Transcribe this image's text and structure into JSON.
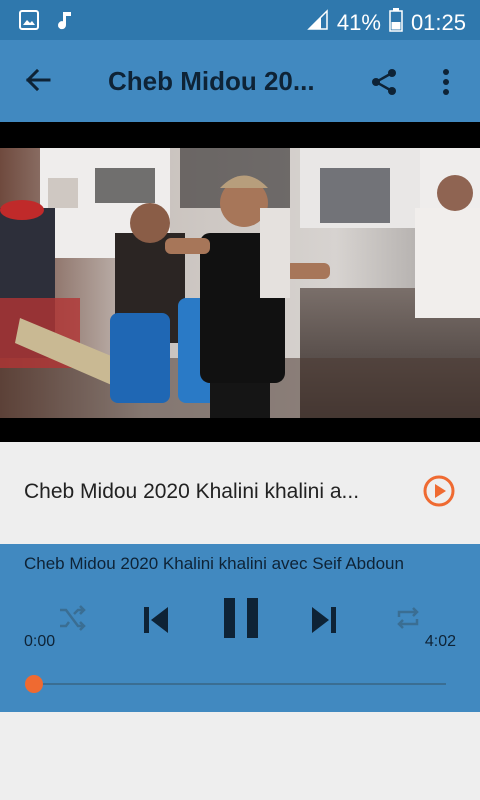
{
  "status_bar": {
    "battery": "41%",
    "time": "01:25",
    "icons": [
      "image-icon",
      "music-note-icon",
      "signal-icon",
      "battery-icon"
    ]
  },
  "app_bar": {
    "title": "Cheb Midou 20...",
    "icons": [
      "back-arrow-icon",
      "share-icon",
      "more-vert-icon"
    ]
  },
  "track_row": {
    "title": "Cheb Midou 2020 Khalini khalini a..."
  },
  "player": {
    "now_playing": "Cheb Midou 2020 Khalini khalini avec Seif Abdoun",
    "elapsed": "0:00",
    "duration": "4:02",
    "progress": 0.0,
    "shuffle_enabled": false,
    "repeat_enabled": false
  },
  "colors": {
    "status_bar": "#2f78ad",
    "app_bar": "#4189c0",
    "accent": "#ef6a31",
    "background": "#eeeeee"
  }
}
